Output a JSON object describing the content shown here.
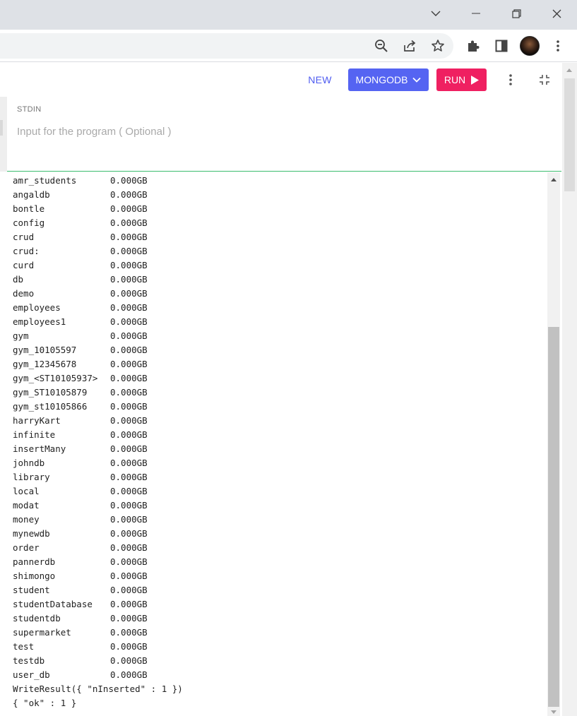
{
  "window": {
    "controls": [
      "chevron-down-icon",
      "minimize-icon",
      "restore-icon",
      "close-icon"
    ]
  },
  "browser_toolbar": {
    "icons": [
      "zoom-out-icon",
      "share-icon",
      "bookmark-star-icon",
      "extensions-puzzle-icon",
      "side-panel-icon",
      "profile-avatar",
      "more-menu-icon"
    ]
  },
  "header": {
    "new_label": "NEW",
    "language_label": "MONGODB",
    "run_label": "RUN",
    "accent_color": "#5564f2",
    "run_color": "#ef2061"
  },
  "stdin": {
    "label": "STDIN",
    "placeholder": "Input for the program ( Optional )"
  },
  "output": {
    "databases": [
      {
        "name": "amr_students",
        "size": "0.000GB"
      },
      {
        "name": "angaldb",
        "size": "0.000GB"
      },
      {
        "name": "bontle",
        "size": "0.000GB"
      },
      {
        "name": "config",
        "size": "0.000GB"
      },
      {
        "name": "crud",
        "size": "0.000GB"
      },
      {
        "name": "crud:",
        "size": "0.000GB"
      },
      {
        "name": "curd",
        "size": "0.000GB"
      },
      {
        "name": "db",
        "size": "0.000GB"
      },
      {
        "name": "demo",
        "size": "0.000GB"
      },
      {
        "name": "employees",
        "size": "0.000GB"
      },
      {
        "name": "employees1",
        "size": "0.000GB"
      },
      {
        "name": "gym",
        "size": "0.000GB"
      },
      {
        "name": "gym_10105597",
        "size": "0.000GB"
      },
      {
        "name": "gym_12345678",
        "size": "0.000GB"
      },
      {
        "name": "gym_<ST10105937>",
        "size": "0.000GB"
      },
      {
        "name": "gym_ST10105879",
        "size": "0.000GB"
      },
      {
        "name": "gym_st10105866",
        "size": "0.000GB"
      },
      {
        "name": "harryKart",
        "size": "0.000GB"
      },
      {
        "name": "infinite",
        "size": "0.000GB"
      },
      {
        "name": "insertMany",
        "size": "0.000GB"
      },
      {
        "name": "johndb",
        "size": "0.000GB"
      },
      {
        "name": "library",
        "size": "0.000GB"
      },
      {
        "name": "local",
        "size": "0.000GB"
      },
      {
        "name": "modat",
        "size": "0.000GB"
      },
      {
        "name": "money",
        "size": "0.000GB"
      },
      {
        "name": "mynewdb",
        "size": "0.000GB"
      },
      {
        "name": "order",
        "size": "0.000GB"
      },
      {
        "name": "pannerdb",
        "size": "0.000GB"
      },
      {
        "name": "shimongo",
        "size": "0.000GB"
      },
      {
        "name": "student",
        "size": "0.000GB"
      },
      {
        "name": "studentDatabase",
        "size": "0.000GB"
      },
      {
        "name": "studentdb",
        "size": "0.000GB"
      },
      {
        "name": "supermarket",
        "size": "0.000GB"
      },
      {
        "name": "test",
        "size": "0.000GB"
      },
      {
        "name": "testdb",
        "size": "0.000GB"
      },
      {
        "name": "user_db",
        "size": "0.000GB"
      }
    ],
    "write_result": "WriteResult({ \"nInserted\" : 1 })",
    "ok_result": "{ \"ok\" : 1 }"
  }
}
